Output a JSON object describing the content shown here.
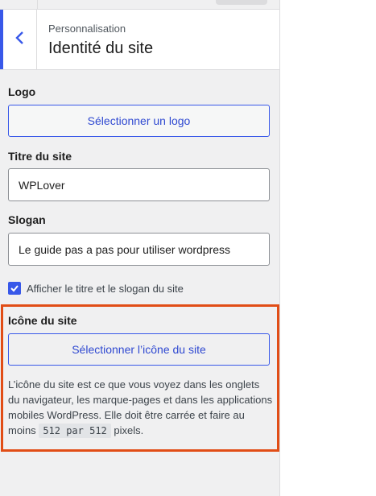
{
  "header": {
    "subtitle": "Personnalisation",
    "title": "Identité du site",
    "back_icon": "chevron-left-icon"
  },
  "logo": {
    "label": "Logo",
    "button_label": "Sélectionner un logo"
  },
  "site_title": {
    "label": "Titre du site",
    "value": "WPLover"
  },
  "tagline": {
    "label": "Slogan",
    "value": "Le guide pas a pas pour utiliser wordpress"
  },
  "display_option": {
    "label": "Afficher le titre et le slogan du site",
    "checked": true
  },
  "site_icon": {
    "label": "Icône du site",
    "button_label": "Sélectionner l’icône du site",
    "description_before": "L’icône du site est ce que vous voyez dans les onglets du navigateur, les marque-pages et dans les applications mobiles WordPress. Elle doit être carrée et faire au moins",
    "size_code": "512 par 512",
    "description_after": "pixels."
  },
  "colors": {
    "accent": "#3858e9",
    "highlight": "#e14d16",
    "panel_bg": "#f0f0f1"
  }
}
